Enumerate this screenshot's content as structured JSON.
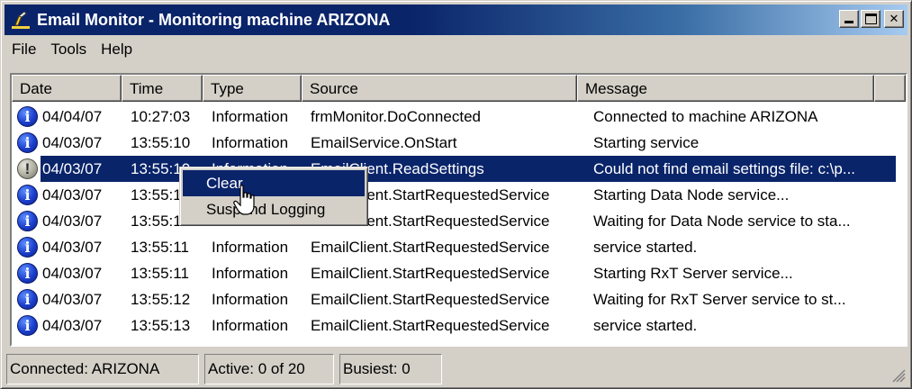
{
  "window": {
    "title": "Email Monitor - Monitoring machine ARIZONA",
    "minimize_label": "_",
    "close_label": "✕"
  },
  "menu": [
    "File",
    "Tools",
    "Help"
  ],
  "columns": [
    "Date",
    "Time",
    "Type",
    "Source",
    "Message"
  ],
  "rows": [
    {
      "icon": "info-icon",
      "date": "04/04/07",
      "time": "10:27:03",
      "type": "Information",
      "source": "frmMonitor.DoConnected",
      "message": "Connected to machine ARIZONA"
    },
    {
      "icon": "info-icon",
      "date": "04/03/07",
      "time": "13:55:10",
      "type": "Information",
      "source": "EmailService.OnStart",
      "message": "Starting service"
    },
    {
      "icon": "warning-icon",
      "date": "04/03/07",
      "time": "13:55:10",
      "type": "Information",
      "source": "EmailClient.ReadSettings",
      "message": "Could not find email settings file: c:\\p..."
    },
    {
      "icon": "info-icon",
      "date": "04/03/07",
      "time": "13:55:11",
      "type": "Information",
      "source": "EmailClient.StartRequestedService",
      "message": "Starting Data Node service..."
    },
    {
      "icon": "info-icon",
      "date": "04/03/07",
      "time": "13:55:11",
      "type": "Information",
      "source": "EmailClient.StartRequestedService",
      "message": "Waiting for Data Node service to sta..."
    },
    {
      "icon": "info-icon",
      "date": "04/03/07",
      "time": "13:55:11",
      "type": "Information",
      "source": "EmailClient.StartRequestedService",
      "message": " service started."
    },
    {
      "icon": "info-icon",
      "date": "04/03/07",
      "time": "13:55:11",
      "type": "Information",
      "source": "EmailClient.StartRequestedService",
      "message": "Starting RxT Server service..."
    },
    {
      "icon": "info-icon",
      "date": "04/03/07",
      "time": "13:55:12",
      "type": "Information",
      "source": "EmailClient.StartRequestedService",
      "message": "Waiting for RxT Server service to st..."
    },
    {
      "icon": "info-icon",
      "date": "04/03/07",
      "time": "13:55:13",
      "type": "Information",
      "source": "EmailClient.StartRequestedService",
      "message": " service started."
    }
  ],
  "selected_row": 2,
  "context_menu": [
    "Clear",
    "Suspend Logging"
  ],
  "status": {
    "connected": "Connected: ARIZONA",
    "active": "Active: 0 of 20",
    "busiest": "Busiest: 0"
  },
  "colors": {
    "selection": "#0a246a",
    "face": "#d4d0c8"
  }
}
